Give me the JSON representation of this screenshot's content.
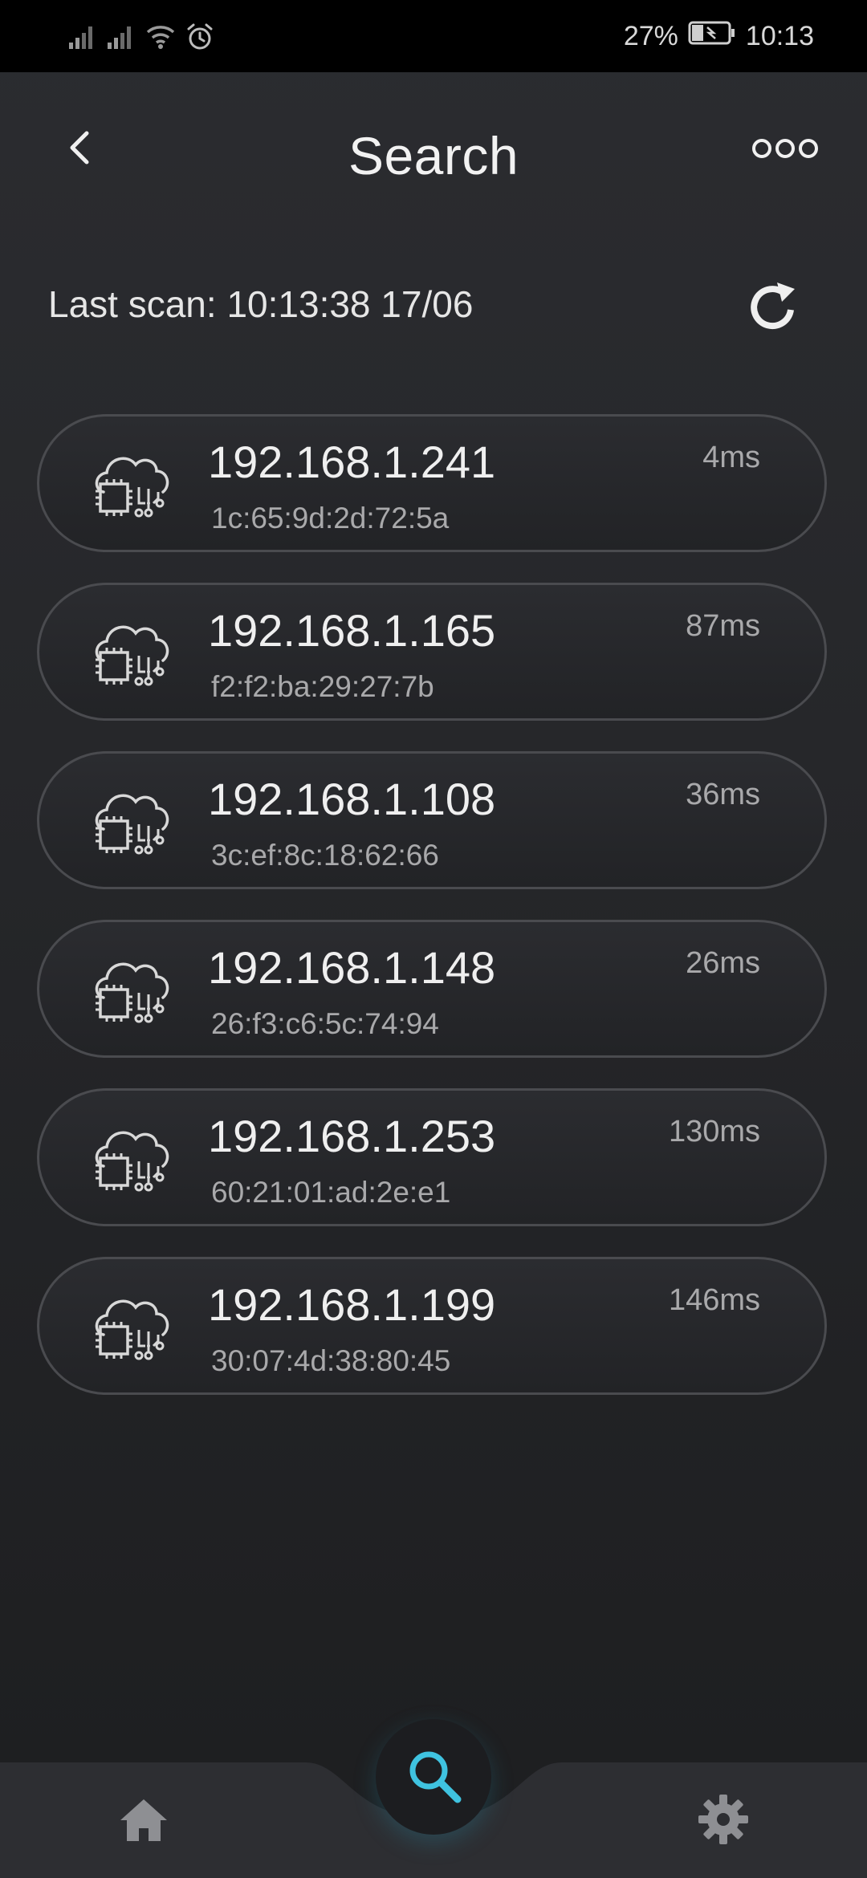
{
  "status_bar": {
    "battery_percent": "27%",
    "time": "10:13",
    "icons": [
      "signal-icon",
      "signal-icon",
      "wifi-icon",
      "alarm-icon",
      "battery-charging-icon"
    ]
  },
  "header": {
    "title": "Search",
    "back_icon": "chevron-left-icon",
    "more_icon": "more-horizontal-icon"
  },
  "scan": {
    "label": "Last scan: 10:13:38 17/06",
    "refresh_icon": "refresh-icon"
  },
  "devices": [
    {
      "ip": "192.168.1.241",
      "mac": "1c:65:9d:2d:72:5a",
      "ping": "4ms"
    },
    {
      "ip": "192.168.1.165",
      "mac": "f2:f2:ba:29:27:7b",
      "ping": "87ms"
    },
    {
      "ip": "192.168.1.108",
      "mac": "3c:ef:8c:18:62:66",
      "ping": "36ms"
    },
    {
      "ip": "192.168.1.148",
      "mac": "26:f3:c6:5c:74:94",
      "ping": "26ms"
    },
    {
      "ip": "192.168.1.253",
      "mac": "60:21:01:ad:2e:e1",
      "ping": "130ms"
    },
    {
      "ip": "192.168.1.199",
      "mac": "30:07:4d:38:80:45",
      "ping": "146ms"
    }
  ],
  "bottom_nav": {
    "items": [
      "home-icon",
      "search-icon",
      "gear-icon"
    ],
    "active": "search-icon"
  },
  "colors": {
    "accent": "#3fc3e0",
    "background": "#26272a",
    "card_border": "#4a4b4f"
  }
}
